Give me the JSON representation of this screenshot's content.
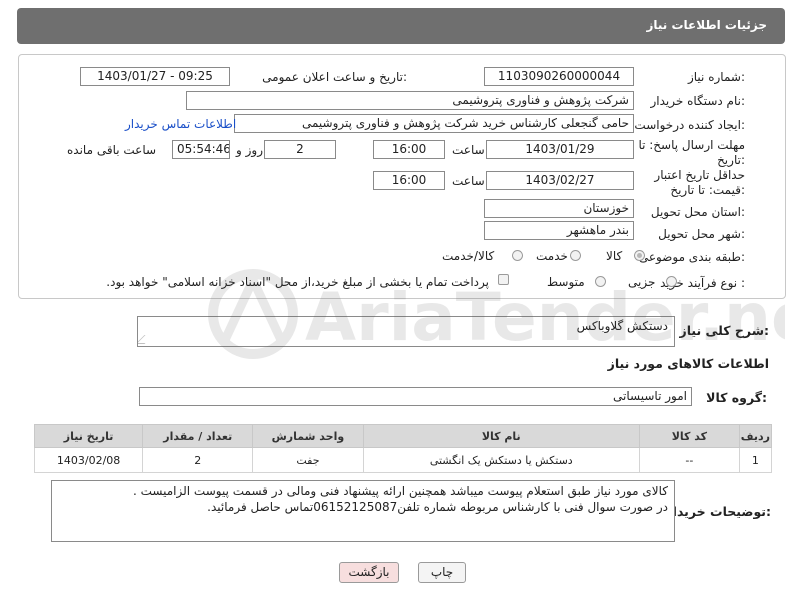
{
  "header": {
    "title": "جزئیات اطلاعات نیاز"
  },
  "need_number": {
    "label": "شماره نیاز:",
    "value": "1103090260000044"
  },
  "announce_date": {
    "label": "تاریخ و ساعت اعلان عمومی:",
    "value": "1403/01/27 - 09:25"
  },
  "buyer_org": {
    "label": "نام دستگاه خریدار:",
    "value": "شرکت پژوهش و فناوری پتروشیمی"
  },
  "requester": {
    "label": "ایجاد کننده درخواست:",
    "value": "حامی گنجعلی کارشناس خرید شرکت پژوهش و فناوری پتروشیمی",
    "contact_link": "اطلاعات تماس خریدار"
  },
  "reply_deadline": {
    "label": "مهلت ارسال پاسخ: تا تاریخ:",
    "date": "1403/01/29",
    "time_label": "ساعت",
    "time": "16:00",
    "days": "2",
    "days_label": "روز و",
    "remaining": "05:54:46",
    "remaining_label": "ساعت باقی مانده"
  },
  "price_deadline": {
    "label": "حداقل تاریخ اعتبار قیمت: تا تاریخ:",
    "date": "1403/02/27",
    "time_label": "ساعت",
    "time": "16:00"
  },
  "delivery_province": {
    "label": "استان محل تحویل:",
    "value": "خوزستان"
  },
  "delivery_city": {
    "label": "شهر محل تحویل:",
    "value": "بندر ماهشهر"
  },
  "category": {
    "label": "طبقه بندی موضوعی:",
    "options": [
      "کالا",
      "خدمت",
      "کالا/خدمت"
    ],
    "selected": "کالا"
  },
  "purchase_type": {
    "label": "نوع فرآیند خرید :",
    "options": [
      "جزیی",
      "متوسط"
    ],
    "note": "پرداخت تمام یا بخشی از مبلغ خرید،از محل \"اسناد خزانه اسلامی\" خواهد بود."
  },
  "general_desc": {
    "label": "شرح کلی نیاز:",
    "value": "دستکش گلاوباکس"
  },
  "goods_info": {
    "title": "اطلاعات کالاهای مورد نیاز"
  },
  "goods_group": {
    "label": "گروه کالا:",
    "value": "امور تاسیساتی"
  },
  "table": {
    "headers": [
      "ردیف",
      "کد کالا",
      "نام کالا",
      "واحد شمارش",
      "تعداد / مقدار",
      "تاریخ نیاز"
    ],
    "rows": [
      [
        "1",
        "--",
        "دستکش یا دستکش یک انگشتی",
        "جفت",
        "2",
        "1403/02/08"
      ]
    ]
  },
  "buyer_notes": {
    "label": "توضیحات خریدار:",
    "line1": "کالای مورد نیاز طبق استعلام پیوست میباشد همچنین ارائه پیشنهاد فنی ومالی در قسمت پیوست الزامیست .",
    "line2": "در صورت سوال فنی با کارشناس مربوطه شماره تلفن06152125087تماس حاصل فرمائید."
  },
  "buttons": {
    "print": "چاپ",
    "back": "بازگشت"
  },
  "watermark": {
    "text": "AriaTender.net"
  },
  "colors": {
    "header_bg": "#6f6f6f",
    "link": "#1a4fc8",
    "back_button_bg": "#f7dede"
  }
}
